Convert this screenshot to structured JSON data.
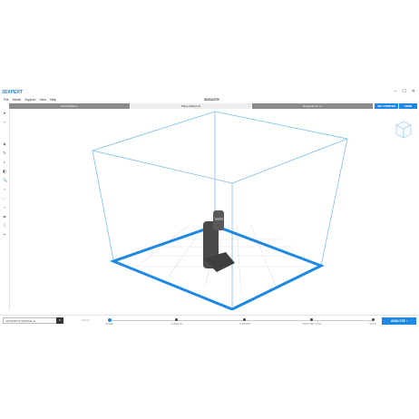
{
  "app": {
    "logo": "3DXPERT",
    "menu": [
      "File",
      "Model",
      "Support",
      "View",
      "Help"
    ],
    "brand": "3DSUITE",
    "window_controls": [
      "–",
      "☐",
      "✕"
    ]
  },
  "tabs": [
    {
      "label": "Print Platform",
      "active": false
    },
    {
      "label": "Place Model (1)",
      "active": true
    },
    {
      "label": "Supports (0 / 1)",
      "active": false
    }
  ],
  "top_buttons": {
    "left": "SET PRINTER",
    "right": "SEND"
  },
  "toolbar": {
    "tools": [
      {
        "name": "select-icon",
        "glyph": "➤",
        "disabled": false
      },
      {
        "name": "add-model-icon",
        "glyph": "+",
        "disabled": false
      },
      {
        "name": "orient-icon",
        "glyph": "◈",
        "disabled": false
      },
      {
        "name": "rotate-icon",
        "glyph": "↻",
        "disabled": false
      },
      {
        "name": "shade-icon",
        "glyph": "◐",
        "disabled": false
      },
      {
        "name": "layer-icon",
        "glyph": "◧",
        "disabled": false
      },
      {
        "name": "zoom-icon",
        "glyph": "🔍",
        "disabled": false
      },
      {
        "name": "move-icon",
        "glyph": "⇆",
        "disabled": true
      },
      {
        "name": "scale-icon",
        "glyph": "⤢",
        "disabled": true
      },
      {
        "name": "mirror-icon",
        "glyph": "⇋",
        "disabled": true
      },
      {
        "name": "arrange-icon",
        "glyph": "⇄",
        "disabled": false
      },
      {
        "name": "duplicate-icon",
        "glyph": "⎘",
        "disabled": true
      },
      {
        "name": "cut-icon",
        "glyph": "✂",
        "disabled": false
      }
    ]
  },
  "footer": {
    "job_name": "3DXPERT-8 SAMPLE.stl",
    "job_button": "▾",
    "back_label": "< BACK",
    "steps": [
      {
        "label": "MODEL",
        "active": true
      },
      {
        "label": "SAMPLING",
        "active": false
      },
      {
        "label": "SUPPORT",
        "active": false
      },
      {
        "label": "PRINT SETTINGS",
        "active": false
      },
      {
        "label": "SLICE",
        "active": false
      }
    ],
    "analyze_label": "ANALYZE  ›"
  },
  "colors": {
    "accent": "#1e88e5",
    "box": "#7fbde9",
    "model": "#4d4d4d"
  }
}
